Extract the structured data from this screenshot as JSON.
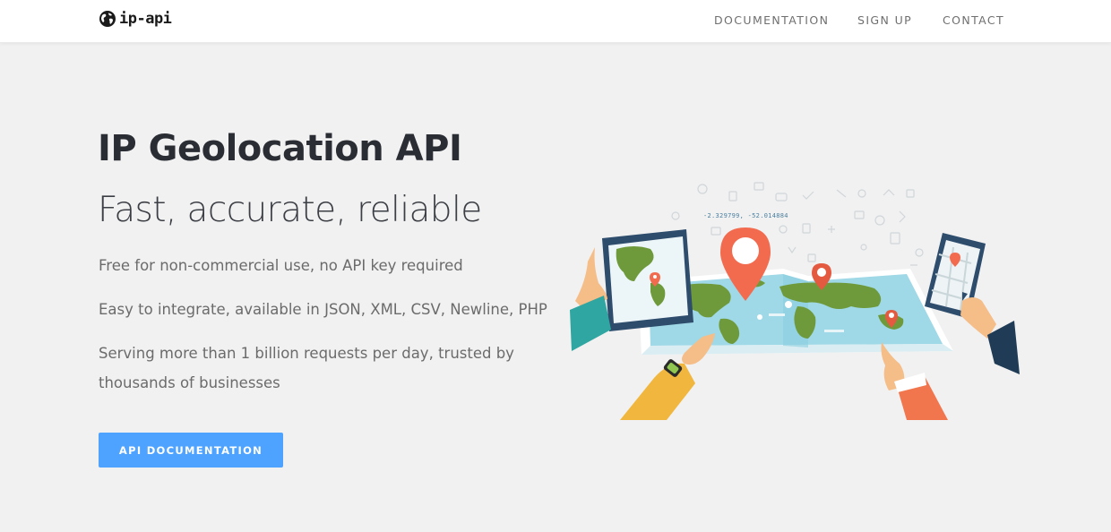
{
  "brand": {
    "name": "ip-api",
    "logo_icon": "globe-icon"
  },
  "nav": {
    "items": [
      {
        "label": "DOCUMENTATION"
      },
      {
        "label": "SIGN UP"
      },
      {
        "label": "CONTACT"
      }
    ]
  },
  "hero": {
    "title": "IP Geolocation API",
    "subtitle": "Fast, accurate, reliable",
    "features": [
      "Free for non-commercial use, no API key required",
      "Easy to integrate, available in JSON, XML, CSV, Newline, PHP",
      "Serving more than 1 billion requests per day, trusted by thousands of businesses"
    ],
    "cta_label": "API DOCUMENTATION",
    "illustration": {
      "coordinates_text": "-2.329799, -52.014884",
      "icon": "map-illustration"
    }
  },
  "colors": {
    "accent": "#4da3ff",
    "background": "#f1f1f1",
    "header_bg": "#ffffff",
    "pin": "#f26b4f",
    "map_water": "#9fd8e6",
    "map_land": "#6f9a3b"
  }
}
